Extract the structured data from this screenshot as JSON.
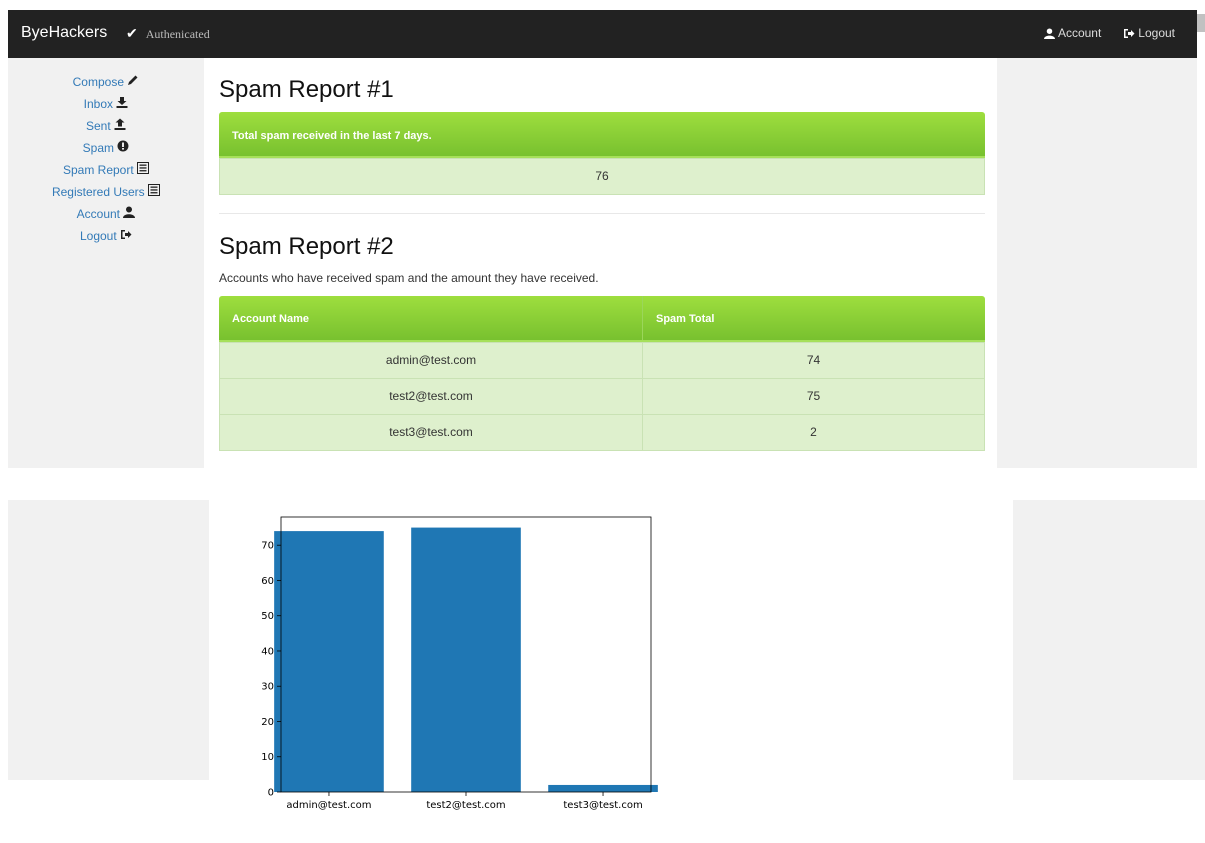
{
  "navbar": {
    "brand": "ByeHackers",
    "auth_status": "Authenicated",
    "account": "Account",
    "logout": "Logout"
  },
  "sidebar": {
    "items": [
      {
        "label": "Compose",
        "icon": "pencil-icon"
      },
      {
        "label": "Inbox",
        "icon": "download-icon"
      },
      {
        "label": "Sent",
        "icon": "upload-icon"
      },
      {
        "label": "Spam",
        "icon": "exclamation-circle-icon"
      },
      {
        "label": "Spam Report",
        "icon": "list-icon"
      },
      {
        "label": "Registered Users",
        "icon": "list-icon"
      },
      {
        "label": "Account",
        "icon": "user-icon"
      },
      {
        "label": "Logout",
        "icon": "logout-icon"
      }
    ]
  },
  "report1": {
    "title": "Spam Report #1",
    "header": "Total spam received in the last 7 days.",
    "value": "76"
  },
  "report2": {
    "title": "Spam Report #2",
    "description": "Accounts who have received spam and the amount they have received.",
    "columns": [
      "Account Name",
      "Spam Total"
    ],
    "rows": [
      {
        "account": "admin@test.com",
        "total": "74"
      },
      {
        "account": "test2@test.com",
        "total": "75"
      },
      {
        "account": "test3@test.com",
        "total": "2"
      }
    ]
  },
  "colors": {
    "navbar": "#222222",
    "link": "#337ab7",
    "header_green": "#8cd13a",
    "cell_green": "#def0cd",
    "bar": "#1f77b4"
  },
  "chart_data": {
    "type": "bar",
    "categories": [
      "admin@test.com",
      "test2@test.com",
      "test3@test.com"
    ],
    "values": [
      74,
      75,
      2
    ],
    "title": "",
    "xlabel": "",
    "ylabel": "",
    "ylim": [
      0,
      78
    ],
    "yticks": [
      0,
      10,
      20,
      30,
      40,
      50,
      60,
      70
    ],
    "grid": false
  }
}
